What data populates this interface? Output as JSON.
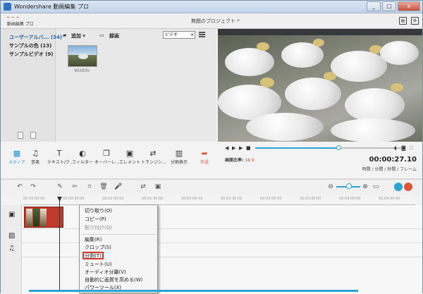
{
  "window": {
    "title": "Wondershare 動画編集 プロ",
    "min": "_",
    "max": "□",
    "close": "x"
  },
  "header": {
    "brand": "動画編集 プロ",
    "project_title": "無題のプロジェクト *"
  },
  "library": {
    "albums": [
      {
        "label": "ユーザーアルバ...",
        "count": "(34)"
      },
      {
        "label": "サンプルの色",
        "count": "(13)"
      },
      {
        "label": "サンプルビデオ",
        "count": "(9)"
      }
    ],
    "add_label": "追加",
    "record_label": "録画",
    "filter_value": "ビデオ",
    "media": [
      {
        "name": "Wildlife"
      }
    ]
  },
  "tools": [
    {
      "icon": "media-icon",
      "glyph": "⬛",
      "label": "メディア"
    },
    {
      "icon": "music-icon",
      "glyph": "♫",
      "label": "音楽"
    },
    {
      "icon": "text-icon",
      "glyph": "T",
      "label": "テキスト/ク..."
    },
    {
      "icon": "filter-icon",
      "glyph": "◐",
      "label": "フィルター"
    },
    {
      "icon": "overlay-icon",
      "glyph": "❐",
      "label": "オーバーレ..."
    },
    {
      "icon": "element-icon",
      "glyph": "▣",
      "label": "エレメント"
    },
    {
      "icon": "transition-icon",
      "glyph": "⇄",
      "label": "トランジシ..."
    },
    {
      "icon": "split-screen-icon",
      "glyph": "▥",
      "label": "分割表示"
    },
    {
      "icon": "export-icon",
      "glyph": "➦",
      "label": "作成"
    }
  ],
  "preview": {
    "ratio_label": "画面比率:",
    "ratio_value": "16:9",
    "timecode": "00:00:27.10",
    "timecode_format": "時間 / 分間 / 秒間 / フレーム",
    "progress": 0.55
  },
  "ruler": {
    "ticks": [
      "00:00:00:00",
      "00:00:30:00",
      "00:01:00:00",
      "00:01:30:00",
      "00:02:00:00",
      "00:02:30:00",
      "00:03:00:00",
      "00:03:30:00",
      "00:04:00:00",
      "00:04:30:00"
    ]
  },
  "context_menu": {
    "items": [
      {
        "label": "切り取り(O)",
        "enabled": true
      },
      {
        "label": "コピー(P)",
        "enabled": true
      },
      {
        "label": "貼り付け(Q)",
        "enabled": false
      },
      {
        "label": "編集(R)",
        "enabled": true
      },
      {
        "label": "クロップ(S)",
        "enabled": true
      },
      {
        "label": "分割(T)",
        "enabled": true,
        "highlighted": true
      },
      {
        "label": "ミュート(U)",
        "enabled": true
      },
      {
        "label": "オーディオ分離(V)",
        "enabled": true
      },
      {
        "label": "自動的に画質を高める(W)",
        "enabled": true
      },
      {
        "label": "パワーツール(X)",
        "enabled": true
      }
    ]
  },
  "colors": {
    "accent": "#2ba3d4",
    "brand": "#d2462f",
    "highlight_border": "#d23b2c"
  }
}
